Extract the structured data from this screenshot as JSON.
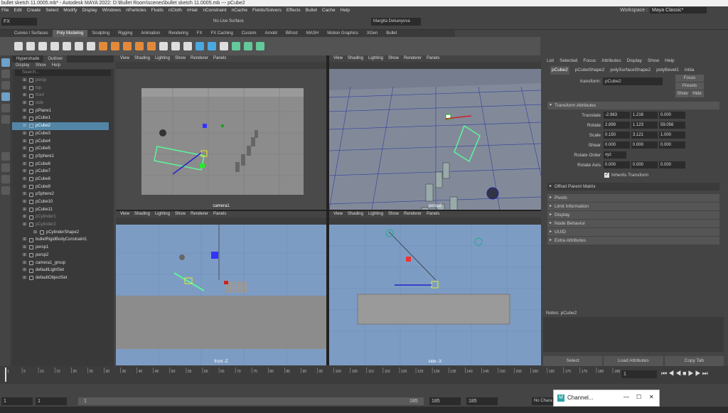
{
  "window": {
    "title": "bullet sketch 11.0005.mb* - Autodesk MAYA 2022: D:\\Bullet Room\\scenes\\bullet sketch 11.0005.mb --- pCube2"
  },
  "menubar": {
    "items": [
      "File",
      "Edit",
      "Create",
      "Select",
      "Modify",
      "Display",
      "Windows",
      "nParticles",
      "Fluids",
      "nCloth",
      "nHair",
      "nConstraint",
      "nCache",
      "Fields/Solvers",
      "Effects",
      "Bullet",
      "Cache",
      "Help"
    ],
    "workspace_label": "Workspace :",
    "workspace_value": "Maya Classic*"
  },
  "statusline": {
    "mode": "FX",
    "live_surface": "No Live Surface",
    "user": "Margita Dekanyova"
  },
  "shelf": {
    "tabs": [
      "Curves / Surfaces",
      "Poly Modeling",
      "Sculpting",
      "Rigging",
      "Animation",
      "Rendering",
      "FX",
      "FX Caching",
      "Custom",
      "Arnold",
      "Bifrost",
      "MASH",
      "Motion Graphics",
      "XGen",
      "Bullet"
    ],
    "active_tab": "Poly Modeling"
  },
  "outliner": {
    "tabs": [
      "Hypershade",
      "Outliner"
    ],
    "active_tab": "Outliner",
    "menu": [
      "Display",
      "Show",
      "Help"
    ],
    "search_placeholder": "Search...",
    "items": [
      {
        "label": "persp",
        "dim": true
      },
      {
        "label": "top",
        "dim": true
      },
      {
        "label": "front",
        "dim": true
      },
      {
        "label": "side",
        "dim": true
      },
      {
        "label": "pPlane1"
      },
      {
        "label": "pCube1"
      },
      {
        "label": "pCube2",
        "selected": true
      },
      {
        "label": "pCube3"
      },
      {
        "label": "pCube4"
      },
      {
        "label": "pCube5"
      },
      {
        "label": "pSphere1"
      },
      {
        "label": "pCube6"
      },
      {
        "label": "pCube7"
      },
      {
        "label": "pCube8"
      },
      {
        "label": "pCube9"
      },
      {
        "label": "pSphere2"
      },
      {
        "label": "pCube10"
      },
      {
        "label": "pCube11"
      },
      {
        "label": "pCylinder1",
        "dim": true
      },
      {
        "label": "pCylinder2",
        "dim": true
      },
      {
        "label": "pCylinderShape2",
        "indent": true
      },
      {
        "label": "bulletRigidBodyConstraint1"
      },
      {
        "label": "persp1"
      },
      {
        "label": "persp2"
      },
      {
        "label": "camera1_group"
      },
      {
        "label": "defaultLightSet"
      },
      {
        "label": "defaultObjectSet"
      }
    ]
  },
  "viewports": {
    "menu": [
      "View",
      "Shading",
      "Lighting",
      "Show",
      "Renderer",
      "Panels"
    ],
    "panels": [
      {
        "name": "camera1"
      },
      {
        "name": "persp2"
      },
      {
        "name": "front -Z"
      },
      {
        "name": "side -X"
      }
    ]
  },
  "channelbox": {
    "menu": [
      "List",
      "Selected",
      "Focus",
      "Attributes",
      "Display",
      "Show",
      "Help"
    ],
    "tabs": [
      "pCube2",
      "pCubeShape2",
      "polySurfaceShape2",
      "polyBevel1",
      "initia"
    ],
    "active_tab": "pCube2",
    "transform_label": "transform:",
    "transform_value": "pCube2",
    "focus_button": "Focus",
    "presets_button": "Presets",
    "show_button": "Show",
    "hide_button": "Hide",
    "section_transform": "Transform Attributes",
    "translate": {
      "label": "Translate",
      "values": [
        "-2.963",
        "1.216",
        "0.000"
      ]
    },
    "rotate": {
      "label": "Rotate",
      "values": [
        "2.899",
        "1.123",
        "59.056"
      ]
    },
    "scale": {
      "label": "Scale",
      "values": [
        "0.150",
        "3.121",
        "1.000"
      ]
    },
    "shear": {
      "label": "Shear",
      "values": [
        "0.000",
        "0.000",
        "0.000"
      ]
    },
    "rotate_order": {
      "label": "Rotate Order",
      "value": "xyz"
    },
    "rotate_axis": {
      "label": "Rotate Axis",
      "values": [
        "0.000",
        "0.000",
        "0.000"
      ]
    },
    "inherits": "Inherits Transform",
    "offset_parent": "Offset Parent Matrix",
    "sections": [
      "Pivots",
      "Limit Information",
      "Display",
      "Node Behavior",
      "UUID",
      "Extra Attributes"
    ],
    "notes_label": "Notes: pCube2",
    "buttons": [
      "Select",
      "Load Attributes",
      "Copy Tab"
    ]
  },
  "timeslider": {
    "ticks": [
      "1",
      "5",
      "10",
      "15",
      "20",
      "25",
      "30",
      "35",
      "40",
      "45",
      "50",
      "55",
      "60",
      "65",
      "70",
      "75",
      "80",
      "85",
      "90",
      "95",
      "100",
      "105",
      "110",
      "115",
      "120",
      "125",
      "130",
      "135",
      "140",
      "145",
      "150",
      "155",
      "160",
      "165",
      "170",
      "175",
      "180",
      "185"
    ],
    "current_frame": "1"
  },
  "rangebar": {
    "start": "1",
    "start2": "1",
    "range_val": "1",
    "end": "185",
    "end2": "185",
    "end3": "185",
    "char_set": "No Chara"
  },
  "channel_window": {
    "title": "Channel..."
  }
}
